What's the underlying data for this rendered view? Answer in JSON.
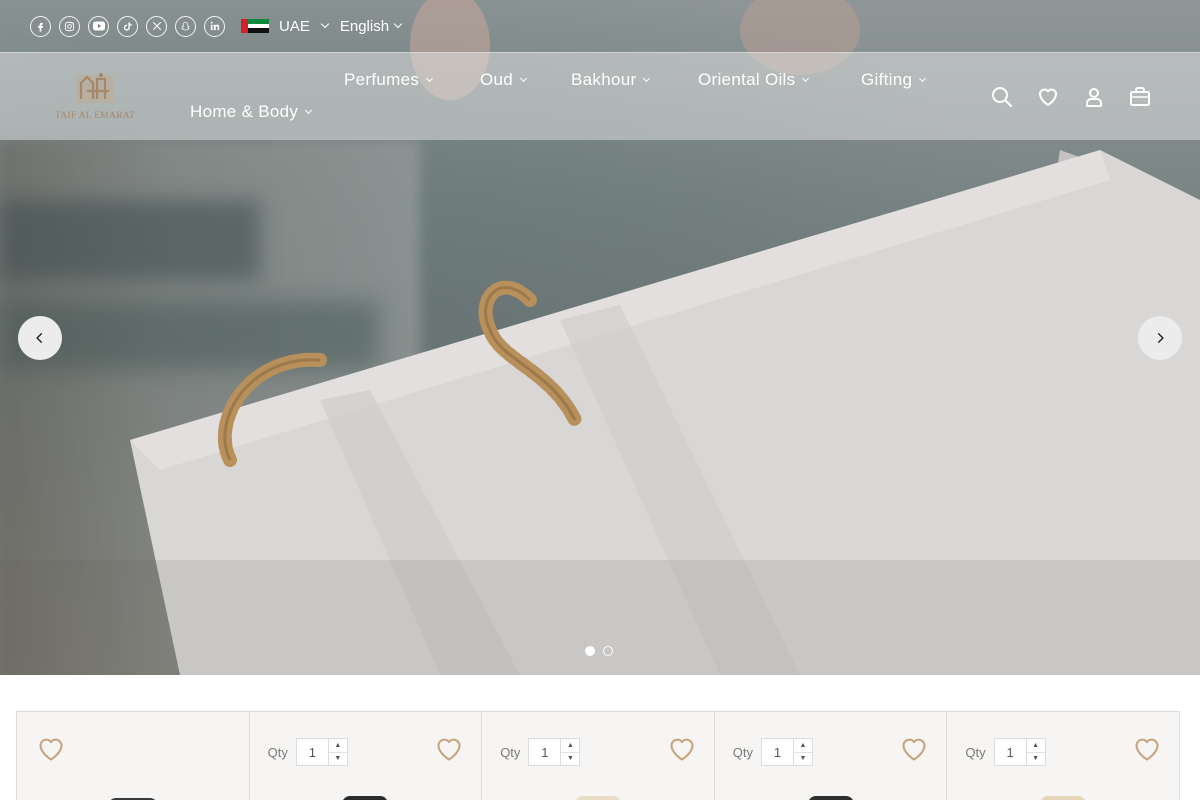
{
  "topbar": {
    "social_icons": [
      "facebook-icon",
      "instagram-icon",
      "youtube-icon",
      "tiktok-icon",
      "x-icon",
      "snapchat-icon",
      "linkedin-icon"
    ],
    "country": "UAE",
    "language": "English"
  },
  "header": {
    "logo_text": "TAIF AL EMARAT",
    "nav": {
      "perfumes": "Perfumes",
      "oud": "Oud",
      "bakhour": "Bakhour",
      "oriental_oils": "Oriental Oils",
      "gifting": "Gifting",
      "home_body": "Home & Body"
    },
    "icons": [
      "search-icon",
      "heart-icon",
      "account-icon",
      "bag-icon"
    ]
  },
  "hero": {
    "slides_count": 2,
    "active_slide": 1,
    "arrows": [
      "chevron-left-icon",
      "chevron-right-icon"
    ]
  },
  "products": {
    "qty_label": "Qty",
    "cards": [
      {
        "show_qty": false,
        "qty": "",
        "thumb_color": "#3a3a3a"
      },
      {
        "show_qty": true,
        "qty": "1",
        "thumb_color": "#2b2b2b"
      },
      {
        "show_qty": true,
        "qty": "1",
        "thumb_color": "#e9dcc4"
      },
      {
        "show_qty": true,
        "qty": "1",
        "thumb_color": "#2e2e2e"
      },
      {
        "show_qty": true,
        "qty": "1",
        "thumb_color": "#e6d6b8"
      }
    ]
  },
  "colors": {
    "accent_gold": "#c8a47e",
    "logo_gold": "#a5876a",
    "card_bg": "#f6f5f3"
  }
}
